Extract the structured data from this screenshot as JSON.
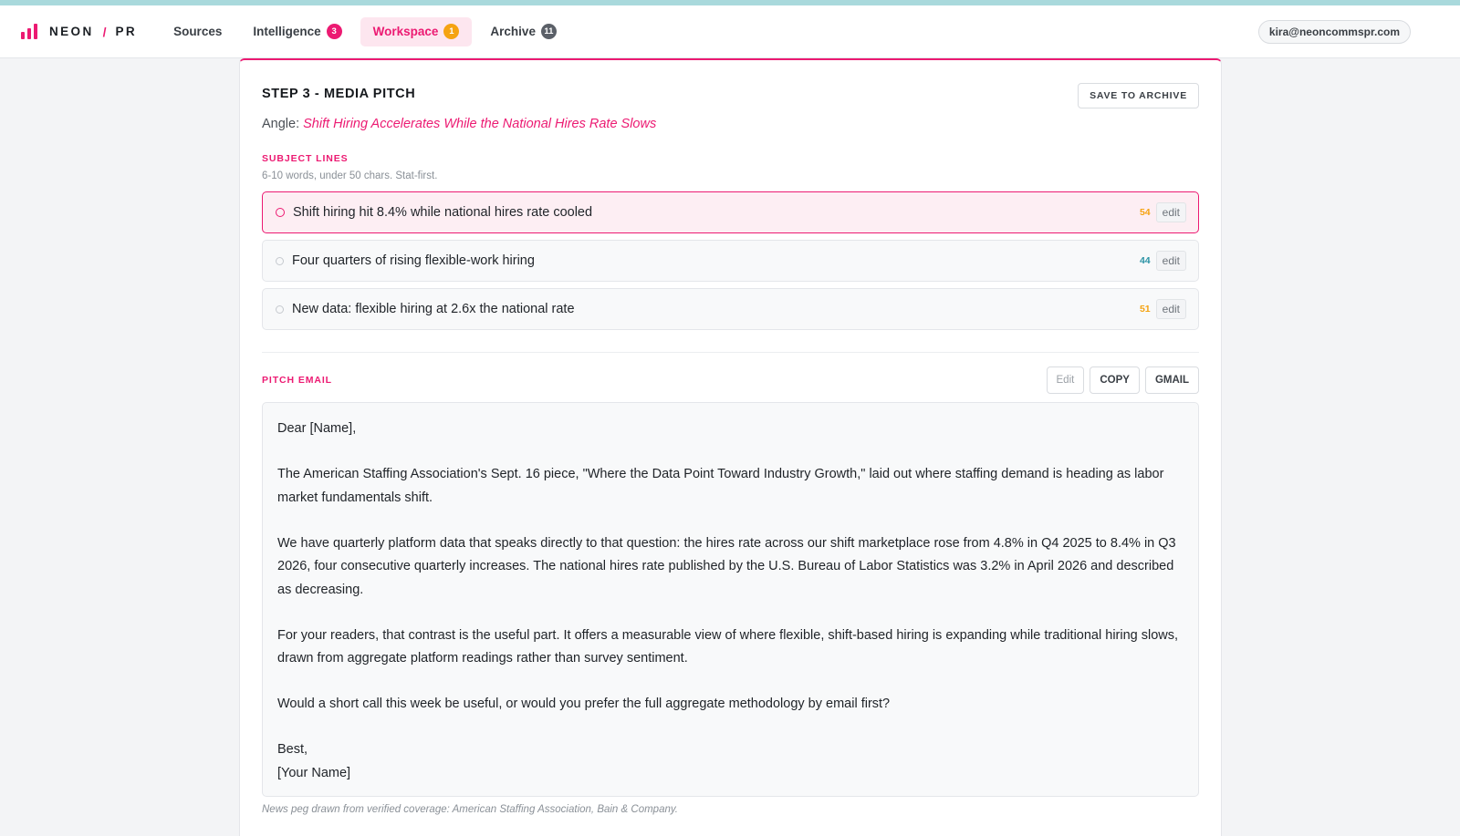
{
  "colors": {
    "accent": "#ec1a72",
    "warning": "#f5a312",
    "ok": "#2a93a5",
    "top_strip": "#a9d9dc"
  },
  "brand": {
    "name": "NEON",
    "slash": "/",
    "suffix": "PR",
    "icon": "bar-chart-icon"
  },
  "nav": [
    {
      "label": "Sources",
      "badge": null,
      "active": false
    },
    {
      "label": "Intelligence",
      "badge": "3",
      "active": false
    },
    {
      "label": "Workspace",
      "badge": "1",
      "active": true
    },
    {
      "label": "Archive",
      "badge": "11",
      "active": false
    }
  ],
  "account": {
    "email": "kira@neoncommspr.com"
  },
  "pitch": {
    "title": "STEP 3 - MEDIA PITCH",
    "save_label": "SAVE TO ARCHIVE",
    "angle_label": "Angle:",
    "angle_value": "Shift Hiring Accelerates While the National Hires Rate Slows"
  },
  "subject_lines": {
    "label": "SUBJECT LINES",
    "hint": "6-10 words, under 50 chars. Stat-first.",
    "items": [
      {
        "text": "Shift hiring hit 8.4% while national hires rate cooled",
        "count": "54",
        "edit": "edit",
        "selected": true
      },
      {
        "text": "Four quarters of rising flexible-work hiring",
        "count": "44",
        "edit": "edit",
        "selected": false
      },
      {
        "text": "New data: flexible hiring at 2.6x the national rate",
        "count": "51",
        "edit": "edit",
        "selected": false
      }
    ]
  },
  "email": {
    "label": "PITCH EMAIL",
    "edit_label": "Edit",
    "copy_label": "COPY",
    "gmail_label": "GMAIL",
    "greeting": "Dear [Name],",
    "p1": "The American Staffing Association's Sept. 16 piece, \"Where the Data Point Toward Industry Growth,\" laid out where staffing demand is heading as labor market fundamentals shift.",
    "p2": "We have quarterly platform data that speaks directly to that question: the hires rate across our shift marketplace rose from 4.8% in Q4 2025 to 8.4% in Q3 2026, four consecutive quarterly increases. The national hires rate published by the U.S. Bureau of Labor Statistics was 3.2% in April 2026 and described as decreasing.",
    "p3": "For your readers, that contrast is the useful part. It offers a measurable view of where flexible, shift-based hiring is expanding while traditional hiring slows, drawn from aggregate platform readings rather than survey sentiment.",
    "p4": "Would a short call this week be useful, or would you prefer the full aggregate methodology by email first?",
    "signoff": "Best,",
    "signature": "[Your Name]"
  },
  "footnote": "News peg drawn from verified coverage: American Staffing Association, Bain & Company."
}
